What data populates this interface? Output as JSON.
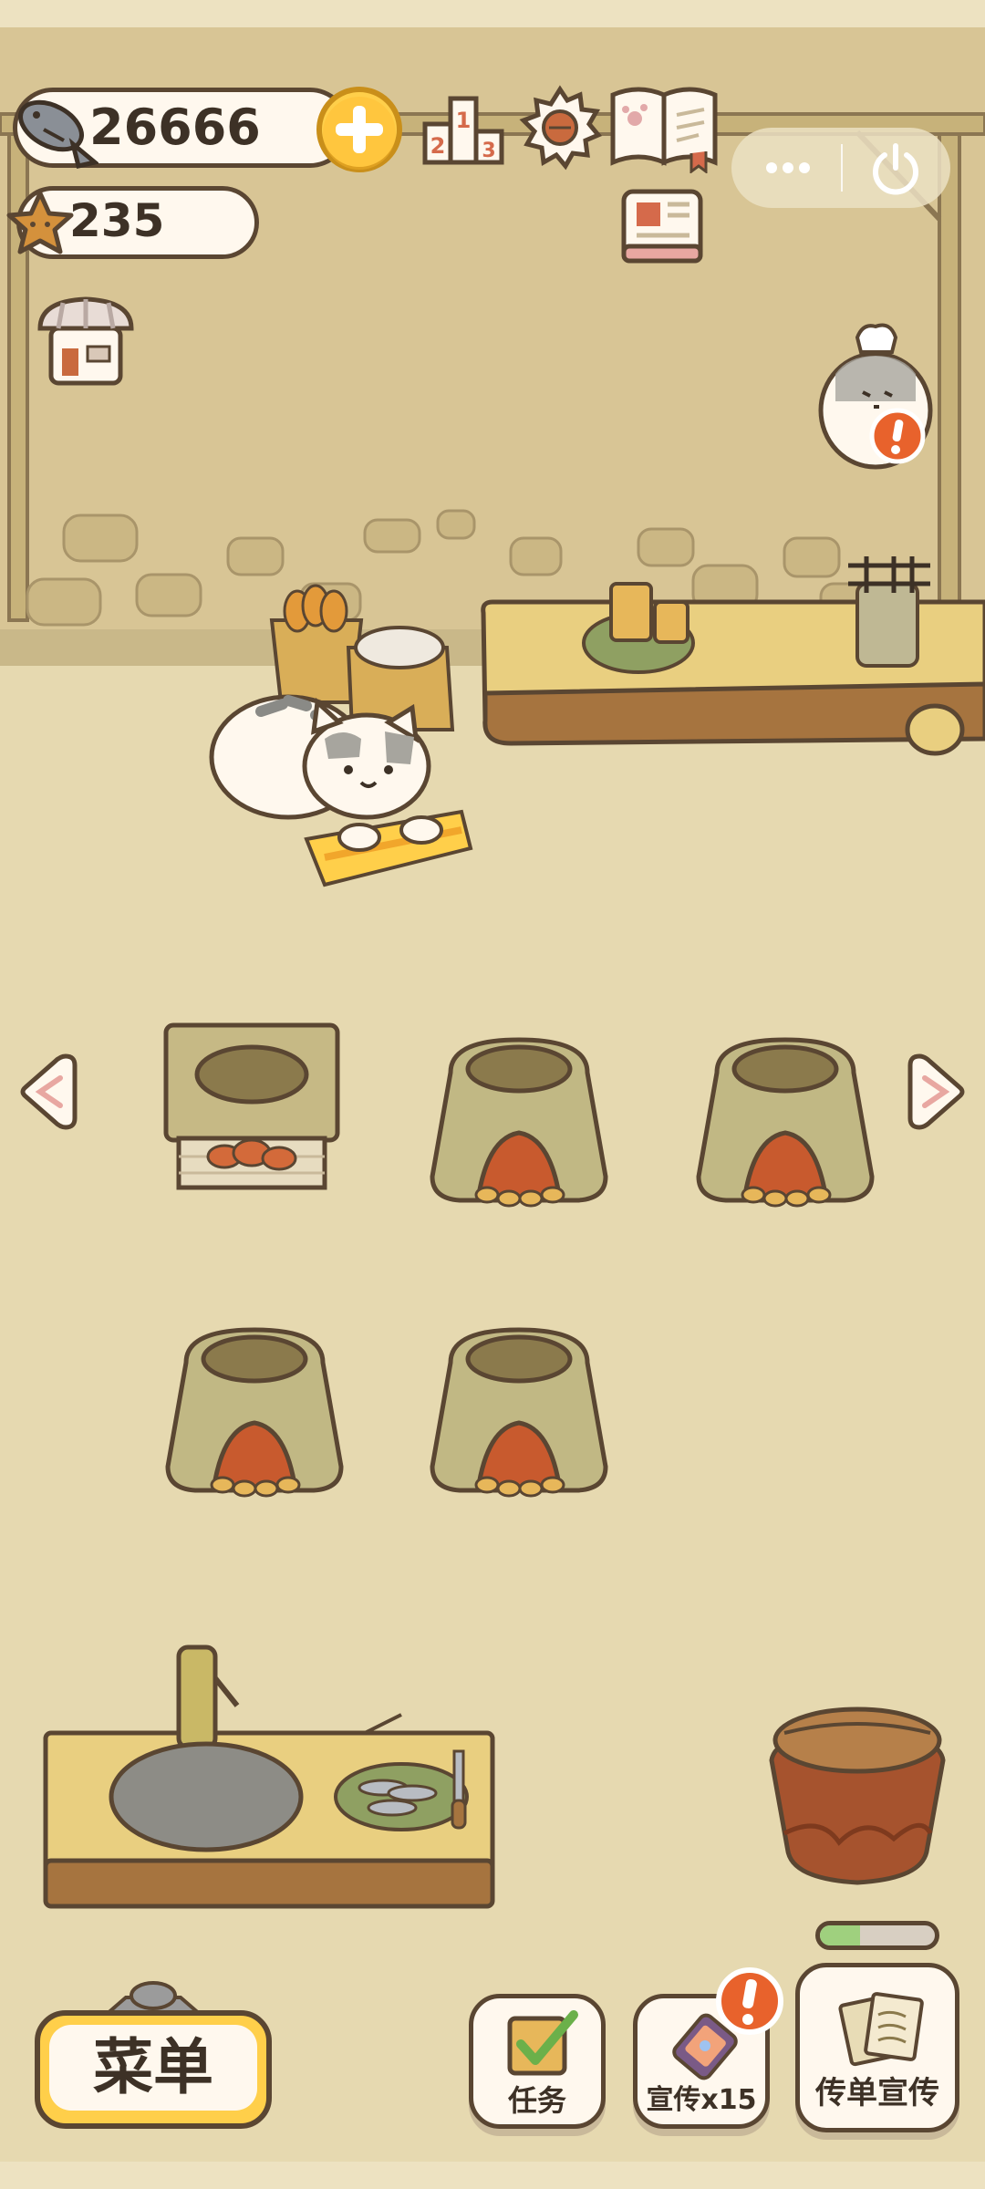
{
  "hud": {
    "fish_count": "26666",
    "star_count": "235"
  },
  "icons": {
    "fish": "fish-icon",
    "plus": "plus-icon",
    "ranking": "ranking-podium-icon",
    "settings": "gear-icon",
    "guide": "book-icon",
    "news": "newspaper-icon",
    "shop": "shop-icon",
    "menu_dots": "more-dots-icon",
    "power": "power-icon",
    "arrow_left": "arrow-left-icon",
    "arrow_right": "arrow-right-icon",
    "alert": "exclamation-icon"
  },
  "buttons": {
    "menu": "菜单",
    "tasks": "任务",
    "promo": "宣传x15",
    "flyer": "传单宣传"
  },
  "progress": {
    "flyer_fill": 0.35
  },
  "colors": {
    "background": "#e6d9b0",
    "wall": "#d8c595",
    "outline": "#5a4632",
    "accent_yellow": "#ffcf4a",
    "alert_orange": "#e8622c"
  }
}
